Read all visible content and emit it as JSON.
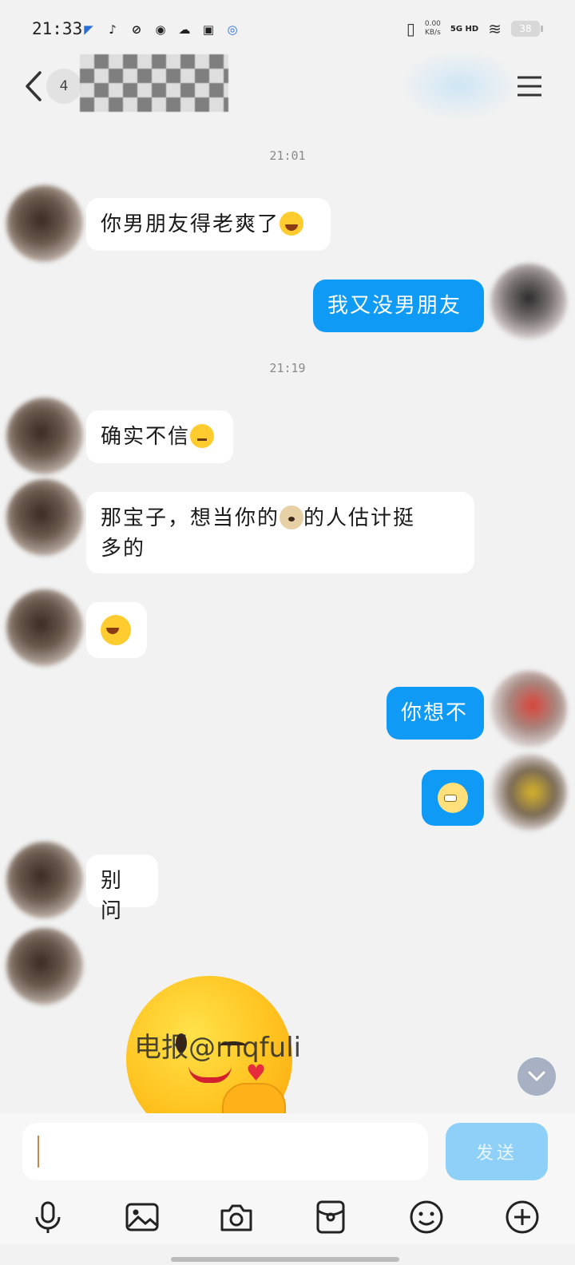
{
  "status_bar": {
    "time": "21:33",
    "net_speed_value": "0.00",
    "net_speed_unit": "KB/s",
    "network": "5G HD",
    "battery": "38"
  },
  "header": {
    "unread_count": "4",
    "contact_name": "",
    "back_icon": "chevron-left-icon",
    "menu_icon": "hamburger-menu-icon"
  },
  "messages": [
    {
      "type": "time",
      "text": "21:01"
    },
    {
      "type": "incoming",
      "text": "你男朋友得老爽了",
      "emoji": "laughing-tears-emoji"
    },
    {
      "type": "outgoing",
      "text": "我又没男朋友"
    },
    {
      "type": "time",
      "text": "21:19"
    },
    {
      "type": "incoming",
      "text": "确实不信",
      "emoji": "thinking-emoji"
    },
    {
      "type": "incoming",
      "text_before": "那宝子，想当你的",
      "emoji": "dog-emoji",
      "text_after": "的人估计挺",
      "text_line2": "多的"
    },
    {
      "type": "incoming",
      "emoji": "laughing-tears-emoji"
    },
    {
      "type": "outgoing",
      "text": "你想不"
    },
    {
      "type": "outgoing",
      "emoji": "grin-emoji"
    },
    {
      "type": "incoming",
      "text": "别问"
    },
    {
      "type": "incoming",
      "sticker": "wink-kiss-sticker"
    }
  ],
  "watermark": "电报@mqfuli",
  "composer": {
    "input_value": "",
    "send_label": "发送"
  },
  "toolbar": {
    "items": [
      "microphone-icon",
      "image-icon",
      "camera-icon",
      "red-packet-icon",
      "emoji-icon",
      "plus-icon"
    ]
  },
  "colors": {
    "background": "#f2f2f2",
    "outgoing_bubble": "#0f9bf5",
    "incoming_bubble": "#ffffff",
    "send_button": "#8fd0f8",
    "scroll_button": "#a8b0c4"
  }
}
